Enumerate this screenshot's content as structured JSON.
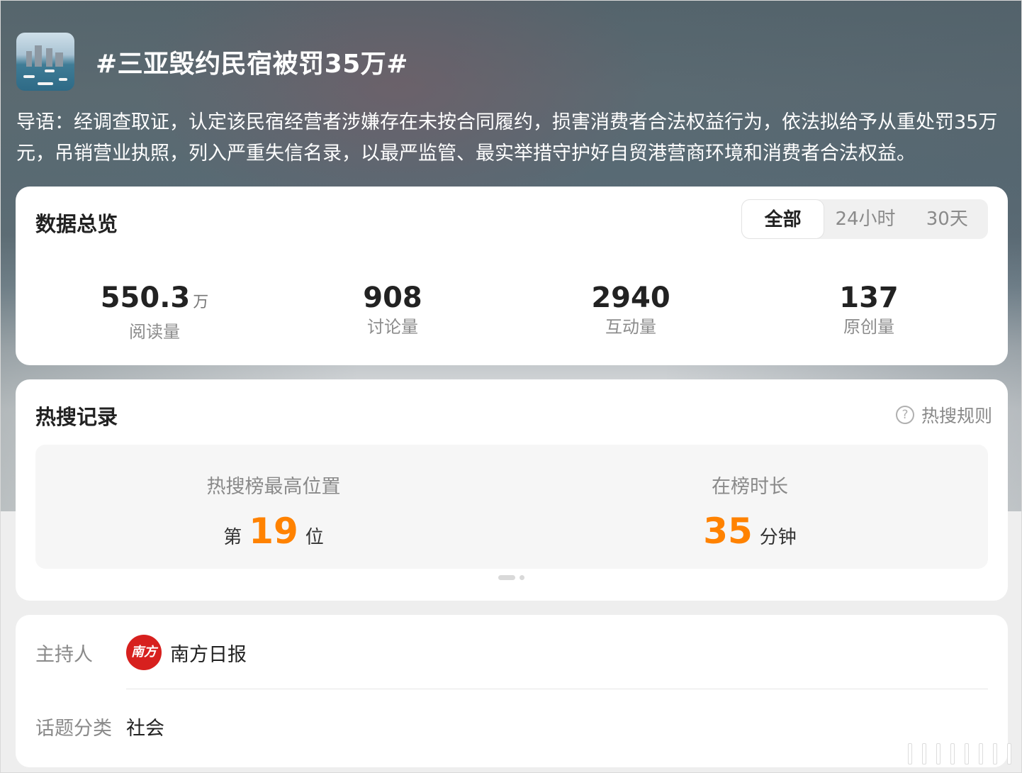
{
  "topic": {
    "title": "#三亚毁约民宿被罚35万#",
    "thumbnail_icon": "topic-thumbnail-image",
    "lead": "导语：经调查取证，认定该民宿经营者涉嫌存在未按合同履约，损害消费者合法权益行为，依法拟给予从重处罚35万元，吊销营业执照，列入严重失信名录，以最严监管、最实举措守护好自贸港营商环境和消费者合法权益。"
  },
  "overview": {
    "title": "数据总览",
    "tabs": [
      "全部",
      "24小时",
      "30天"
    ],
    "active_tab": "全部",
    "stats": [
      {
        "value": "550.3",
        "unit": "万",
        "label": "阅读量"
      },
      {
        "value": "908",
        "unit": "",
        "label": "讨论量"
      },
      {
        "value": "2940",
        "unit": "",
        "label": "互动量"
      },
      {
        "value": "137",
        "unit": "",
        "label": "原创量"
      }
    ]
  },
  "hot_search": {
    "title": "热搜记录",
    "rules_link": "热搜规则",
    "peak": {
      "label": "热搜榜最高位置",
      "prefix": "第",
      "value": "19",
      "suffix": "位"
    },
    "duration": {
      "label": "在榜时长",
      "value": "35",
      "suffix": "分钟"
    },
    "accent_color": "#ff8200"
  },
  "info": {
    "host_label": "主持人",
    "host_name": "南方日报",
    "host_avatar_text": "南方+",
    "category_label": "话题分类",
    "category_value": "社会"
  }
}
